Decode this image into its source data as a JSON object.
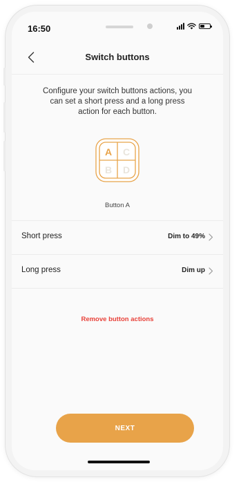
{
  "status_bar": {
    "time": "16:50"
  },
  "nav": {
    "title": "Switch buttons",
    "back_icon": "chevron-left-icon"
  },
  "description": "Configure your switch buttons actions, you can set a short press and a long press action for each button.",
  "switch": {
    "buttons": [
      "A",
      "C",
      "B",
      "D"
    ],
    "selected": "A",
    "caption": "Button A"
  },
  "rows": [
    {
      "label": "Short press",
      "value": "Dim to 49%"
    },
    {
      "label": "Long press",
      "value": "Dim up"
    }
  ],
  "remove_label": "Remove button actions",
  "next_label": "NEXT",
  "colors": {
    "accent": "#e8a349",
    "danger": "#e8423a",
    "inactive_letter": "#e9e5dd"
  }
}
